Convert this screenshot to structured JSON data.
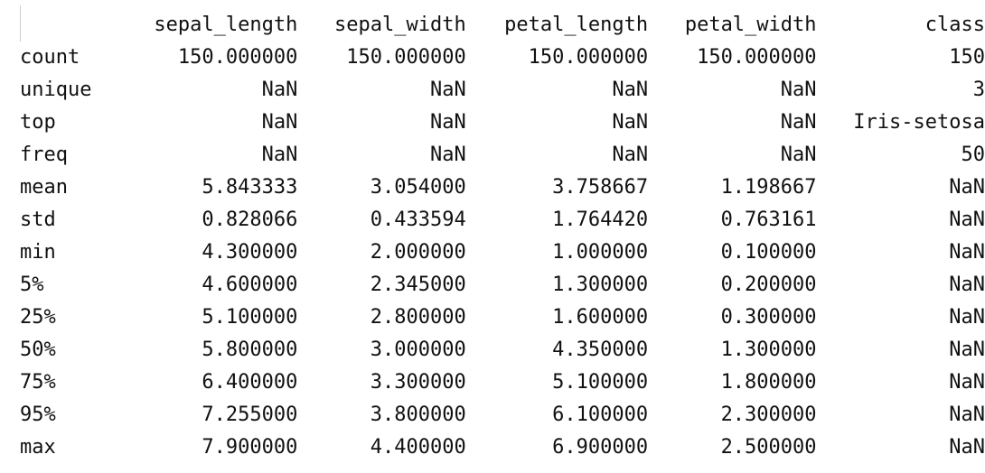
{
  "describe_output": {
    "index_header": "",
    "columns": [
      "sepal_length",
      "sepal_width",
      "petal_length",
      "petal_width",
      "class"
    ],
    "rows": [
      {
        "label": "count",
        "values": [
          "150.000000",
          "150.000000",
          "150.000000",
          "150.000000",
          "150"
        ]
      },
      {
        "label": "unique",
        "values": [
          "NaN",
          "NaN",
          "NaN",
          "NaN",
          "3"
        ]
      },
      {
        "label": "top",
        "values": [
          "NaN",
          "NaN",
          "NaN",
          "NaN",
          "Iris-setosa"
        ]
      },
      {
        "label": "freq",
        "values": [
          "NaN",
          "NaN",
          "NaN",
          "NaN",
          "50"
        ]
      },
      {
        "label": "mean",
        "values": [
          "5.843333",
          "3.054000",
          "3.758667",
          "1.198667",
          "NaN"
        ]
      },
      {
        "label": "std",
        "values": [
          "0.828066",
          "0.433594",
          "1.764420",
          "0.763161",
          "NaN"
        ]
      },
      {
        "label": "min",
        "values": [
          "4.300000",
          "2.000000",
          "1.000000",
          "0.100000",
          "NaN"
        ]
      },
      {
        "label": "5%",
        "values": [
          "4.600000",
          "2.345000",
          "1.300000",
          "0.200000",
          "NaN"
        ]
      },
      {
        "label": "25%",
        "values": [
          "5.100000",
          "2.800000",
          "1.600000",
          "0.300000",
          "NaN"
        ]
      },
      {
        "label": "50%",
        "values": [
          "5.800000",
          "3.000000",
          "4.350000",
          "1.300000",
          "NaN"
        ]
      },
      {
        "label": "75%",
        "values": [
          "6.400000",
          "3.300000",
          "5.100000",
          "1.800000",
          "NaN"
        ]
      },
      {
        "label": "95%",
        "values": [
          "7.255000",
          "3.800000",
          "6.100000",
          "2.300000",
          "NaN"
        ]
      },
      {
        "label": "max",
        "values": [
          "7.900000",
          "4.400000",
          "6.900000",
          "2.500000",
          "NaN"
        ]
      }
    ]
  },
  "colors": {
    "text": "#111111",
    "background": "#ffffff",
    "gutter": "#cccccc"
  }
}
